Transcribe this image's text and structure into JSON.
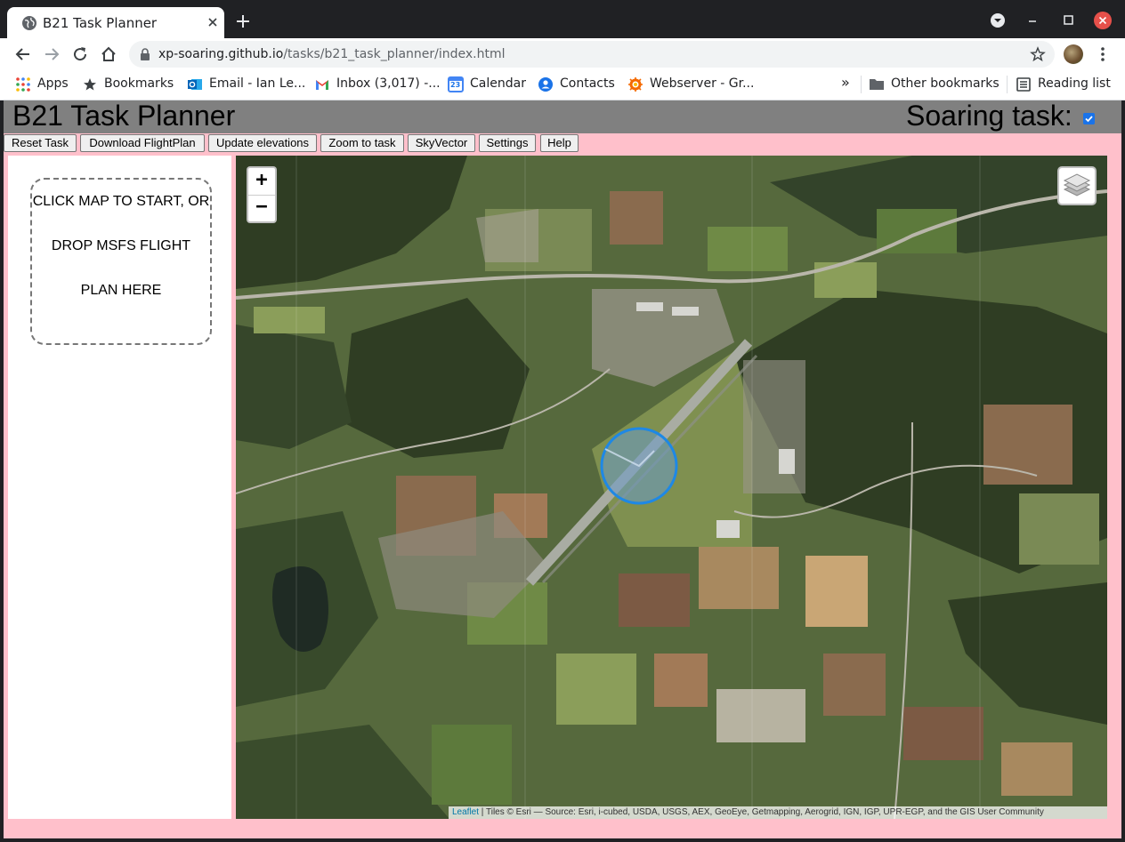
{
  "browser": {
    "tab_title": "B21 Task Planner",
    "url_host": "xp-soaring.github.io",
    "url_path": "/tasks/b21_task_planner/index.html",
    "bookmarks": [
      {
        "label": "Apps",
        "icon": "apps-grid-icon"
      },
      {
        "label": "Bookmarks",
        "icon": "star-icon"
      },
      {
        "label": "Email - Ian Le...",
        "icon": "outlook-icon"
      },
      {
        "label": "Inbox (3,017) -...",
        "icon": "gmail-icon"
      },
      {
        "label": "Calendar",
        "icon": "calendar-icon"
      },
      {
        "label": "Contacts",
        "icon": "contacts-icon"
      },
      {
        "label": "Webserver - Gr...",
        "icon": "webserver-icon"
      }
    ],
    "overflow": "»",
    "other_bookmarks": "Other bookmarks",
    "reading_list": "Reading list",
    "calendar_day": "23"
  },
  "header": {
    "title": "B21 Task Planner",
    "soaring_label": "Soaring task:",
    "soaring_checked": true
  },
  "toolbar": {
    "reset": "Reset Task",
    "download": "Download FlightPlan",
    "update_elevations": "Update elevations",
    "zoom_to_task": "Zoom to task",
    "skyvector": "SkyVector",
    "settings": "Settings",
    "help": "Help"
  },
  "dropzone": {
    "line1": "CLICK MAP TO START, OR",
    "line2": "DROP MSFS FLIGHT",
    "line3": "PLAN HERE"
  },
  "map": {
    "zoom_in": "+",
    "zoom_out": "−",
    "attribution_link": "Leaflet",
    "attribution_text": " | Tiles © Esri — Source: Esri, i-cubed, USDA, USGS, AEX, GeoEye, Getmapping, Aerogrid, IGN, IGP, UPR-EGP, and the GIS User Community",
    "colors": {
      "marker": "#1e88e5",
      "forest": "#2f3d23",
      "field_green": "#5d7a3c",
      "field_brown": "#8a6b4e",
      "runway": "#a9aca3"
    }
  }
}
